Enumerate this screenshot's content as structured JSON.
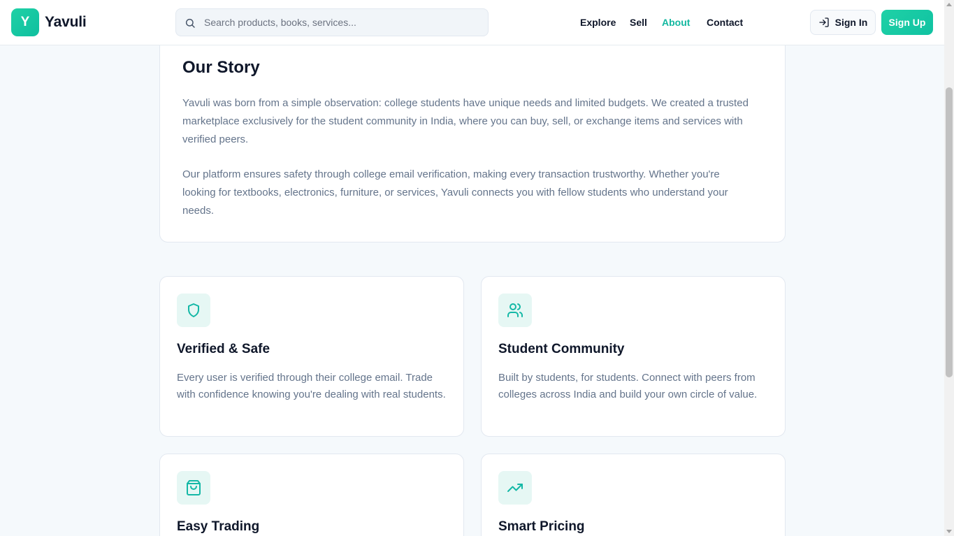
{
  "brand": {
    "logo_letter": "Y",
    "name": "Yavuli"
  },
  "search": {
    "placeholder": "Search products, books, services..."
  },
  "nav": {
    "explore": "Explore",
    "sell": "Sell",
    "about": "About",
    "contact": "Contact"
  },
  "auth": {
    "sign_in": "Sign In",
    "sign_up": "Sign Up"
  },
  "story": {
    "title": "Our Story",
    "paragraph1": "Yavuli was born from a simple observation: college students have unique needs and limited budgets. We created a trusted marketplace exclusively for the student community in India, where you can buy, sell, or exchange items and services with verified peers.",
    "paragraph2": "Our platform ensures safety through college email verification, making every transaction trustworthy. Whether you're looking for textbooks, electronics, furniture, or services, Yavuli connects you with fellow students who understand your needs."
  },
  "features": [
    {
      "icon": "shield-icon",
      "title": "Verified & Safe",
      "text": "Every user is verified through their college email. Trade with confidence knowing you're dealing with real students."
    },
    {
      "icon": "users-icon",
      "title": "Student Community",
      "text": "Built by students, for students. Connect with peers from colleges across India and build your own circle of value."
    },
    {
      "icon": "shopping-bag-icon",
      "title": "Easy Trading",
      "text": ""
    },
    {
      "icon": "trending-up-icon",
      "title": "Smart Pricing",
      "text": ""
    }
  ],
  "colors": {
    "accent": "#13b8a0",
    "background": "#f5f9fc",
    "icon_bg": "#e6f7f4"
  }
}
